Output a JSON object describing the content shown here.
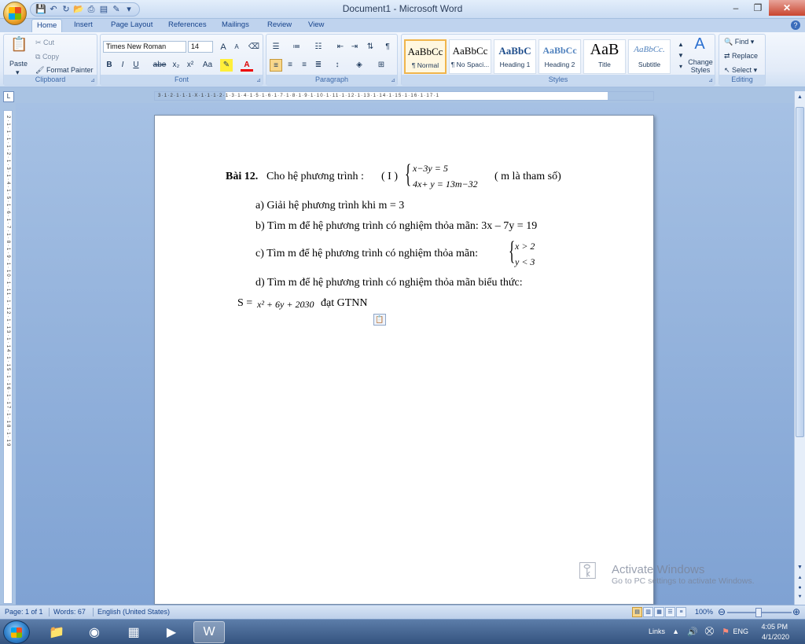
{
  "window": {
    "title": "Document1 - Microsoft Word",
    "minimize": "–",
    "restore": "❐",
    "close": "✕"
  },
  "tabs": [
    "Home",
    "Insert",
    "Page Layout",
    "References",
    "Mailings",
    "Review",
    "View"
  ],
  "active_tab": "Home",
  "ribbon": {
    "clipboard": {
      "label": "Clipboard",
      "paste": "Paste",
      "cut": "Cut",
      "copy": "Copy",
      "format_painter": "Format Painter"
    },
    "font": {
      "label": "Font",
      "font_name": "Times New Roman",
      "font_size": "14",
      "bold": "B",
      "italic": "I",
      "underline": "U",
      "strike": "abe",
      "subscript": "x₂",
      "superscript": "x²",
      "change_case": "Aa",
      "grow": "A",
      "shrink": "A"
    },
    "paragraph": {
      "label": "Paragraph"
    },
    "styles": {
      "label": "Styles",
      "items": [
        {
          "sample": "AaBbCc",
          "name": "¶ Normal"
        },
        {
          "sample": "AaBbCc",
          "name": "¶ No Spaci..."
        },
        {
          "sample": "AaBbC",
          "name": "Heading 1"
        },
        {
          "sample": "AaBbCc",
          "name": "Heading 2"
        },
        {
          "sample": "AaB",
          "name": "Title"
        },
        {
          "sample": "AaBbCc.",
          "name": "Subtitle"
        }
      ],
      "change_styles": "Change Styles"
    },
    "editing": {
      "label": "Editing",
      "find": "Find",
      "replace": "Replace",
      "select": "Select"
    }
  },
  "document": {
    "title_bold": "Bài 12.",
    "title_text": "Cho hệ phương trình :",
    "system_label": "( I )",
    "system_line1": "x−3y = 5",
    "system_line2": "4x+ y = 13m−32",
    "param_note": "( m là tham số)",
    "a": "a) Giải hệ phương trình  khi m = 3",
    "b": "b) Tìm m để hệ phương trình có nghiệm thỏa mãn: 3x – 7y = 19",
    "c": "c) Tìm m để hệ phương trình có nghiệm thỏa mãn:",
    "c_line1": "x > 2",
    "c_line2": "y < 3",
    "d": "d) Tìm m để hệ phương trình có nghiệm thỏa mãn biểu thức:",
    "s_prefix": "S =",
    "s_expr": "x² + 6y + 2030",
    "s_suffix": "đạt GTNN"
  },
  "watermark": {
    "line1": "Activate Windows",
    "line2": "Go to PC settings to activate Windows."
  },
  "statusbar": {
    "page": "Page: 1 of 1",
    "words": "Words: 67",
    "language": "English (United States)",
    "zoom": "100%"
  },
  "taskbar": {
    "links": "Links",
    "lang": "ENG",
    "time": "4:05 PM",
    "date": "4/1/2020"
  }
}
